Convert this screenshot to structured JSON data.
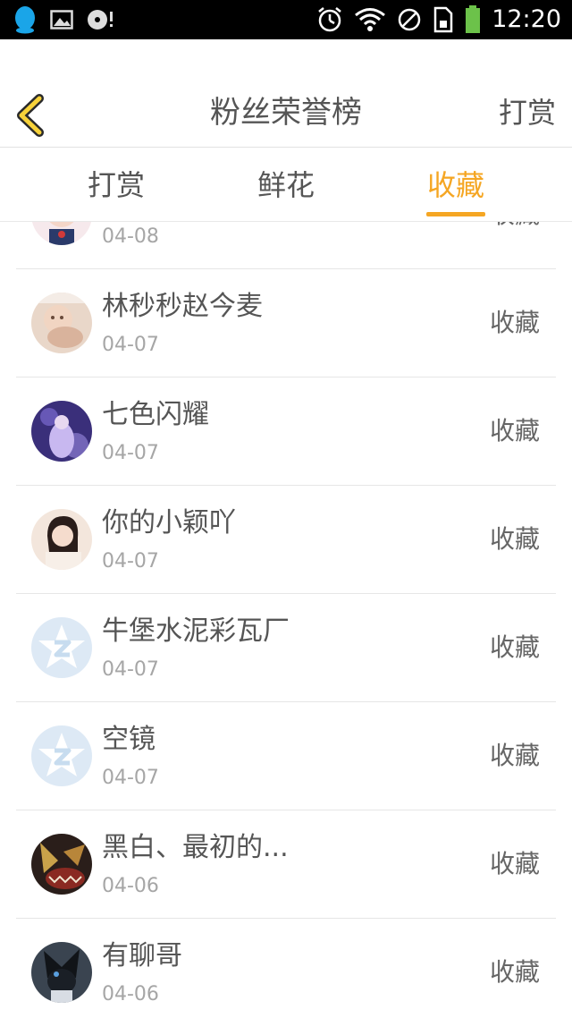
{
  "status_bar": {
    "time": "12:20",
    "left_icons": [
      "qq-icon",
      "image-icon",
      "media-icon"
    ],
    "right_icons": [
      "alarm-icon",
      "wifi-icon",
      "block-icon",
      "sim-icon",
      "battery-icon"
    ]
  },
  "header": {
    "title": "粉丝荣誉榜",
    "right_action": "打赏"
  },
  "tabs": [
    {
      "label": "打赏"
    },
    {
      "label": "鲜花"
    },
    {
      "label": "收藏",
      "active": true
    }
  ],
  "colors": {
    "accent": "#f5a623",
    "status_bar_bg": "#000000"
  },
  "list": [
    {
      "name": "",
      "date": "04-08",
      "action": "收藏",
      "avatar": "cartoon"
    },
    {
      "name": "林秒秒赵今麦",
      "date": "04-07",
      "action": "收藏",
      "avatar": "photo-warm"
    },
    {
      "name": "七色闪耀",
      "date": "04-07",
      "action": "收藏",
      "avatar": "photo-purple"
    },
    {
      "name": "你的小颖吖",
      "date": "04-07",
      "action": "收藏",
      "avatar": "photo-girl"
    },
    {
      "name": "牛堡水泥彩瓦厂",
      "date": "04-07",
      "action": "收藏",
      "avatar": "default-star"
    },
    {
      "name": "空镜",
      "date": "04-07",
      "action": "收藏",
      "avatar": "default-star"
    },
    {
      "name": "黑白、最初的...",
      "date": "04-06",
      "action": "收藏",
      "avatar": "photo-dark-gold"
    },
    {
      "name": "有聊哥",
      "date": "04-06",
      "action": "收藏",
      "avatar": "photo-dark-anime"
    }
  ]
}
